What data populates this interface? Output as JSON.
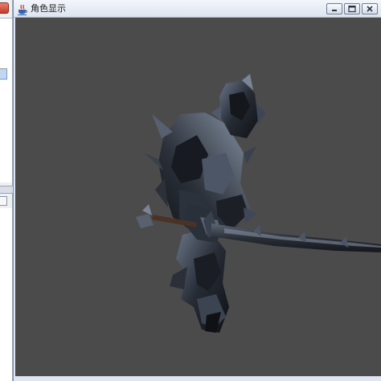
{
  "window": {
    "title": "角色显示",
    "app_icon": "java-cup-icon",
    "controls": [
      "minimize-icon",
      "maximize-icon",
      "close-icon"
    ]
  },
  "viewport": {
    "background_color": "#4b4b4b",
    "content": "3d-armored-knight-with-sword"
  },
  "background_windows": [
    "window-fragment-top",
    "window-fragment-bottom"
  ],
  "colors": {
    "titlebar": "#e3e9f3",
    "close_accent": "#c5392a",
    "armor_dark": "#15181d",
    "armor_highlight": "#8a96a8"
  }
}
